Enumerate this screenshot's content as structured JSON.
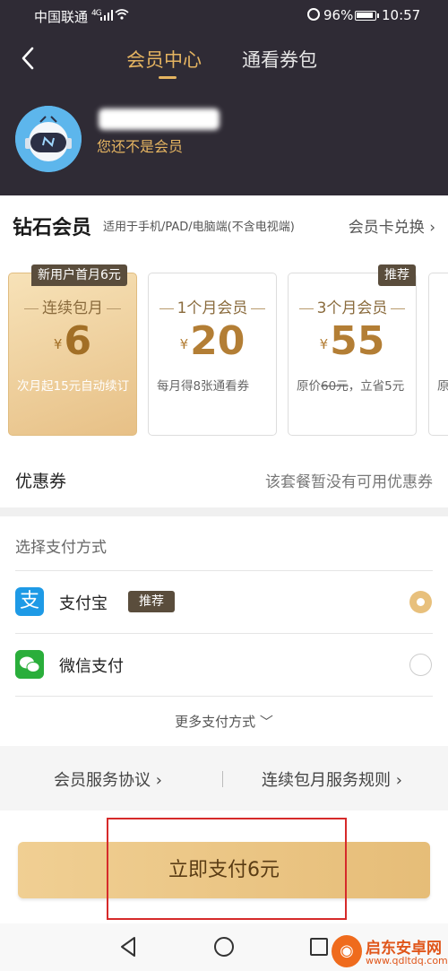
{
  "status_bar": {
    "carrier": "中国联通",
    "network": "4G",
    "battery_pct": "96%",
    "time": "10:57"
  },
  "header": {
    "tabs": [
      {
        "label": "会员中心",
        "active": true
      },
      {
        "label": "通看券包",
        "active": false
      }
    ],
    "member_status": "您还不是会员"
  },
  "membership": {
    "title": "钻石会员",
    "subtitle": "适用于手机/PAD/电脑端(不含电视端)",
    "card_exchange": "会员卡兑换 ›",
    "currency": "¥",
    "plans": [
      {
        "badge": "新用户首月6元",
        "name": "连续包月",
        "price": "6",
        "desc": "次月起15元自动续订",
        "selected": true
      },
      {
        "name": "1个月会员",
        "price": "20",
        "desc": "每月得8张通看券",
        "selected": false
      },
      {
        "badge": "推荐",
        "name": "3个月会员",
        "price": "55",
        "desc_prefix": "原价",
        "desc_strike": "60元",
        "desc_suffix": "，立省5元",
        "selected": false
      }
    ],
    "plan4_partial": "原"
  },
  "coupon": {
    "label": "优惠券",
    "value": "该套餐暂没有可用优惠券"
  },
  "payment": {
    "title": "选择支付方式",
    "methods": [
      {
        "name": "支付宝",
        "icon": "alipay-icon",
        "tag": "推荐",
        "selected": true
      },
      {
        "name": "微信支付",
        "icon": "wechat-icon",
        "selected": false
      }
    ],
    "more": "更多支付方式 ﹀"
  },
  "agreements": {
    "service": "会员服务协议 ›",
    "rules": "连续包月服务规则 ›"
  },
  "pay_button": "立即支付6元",
  "watermark": {
    "name": "启东安卓网",
    "url": "www.qdltdq.com"
  },
  "colors": {
    "header_bg": "#2f2b35",
    "accent_gold": "#e5b461",
    "badge_bg": "#5a4d3c",
    "button_gold": "#ebc485",
    "highlight_red": "#d62a2a"
  }
}
